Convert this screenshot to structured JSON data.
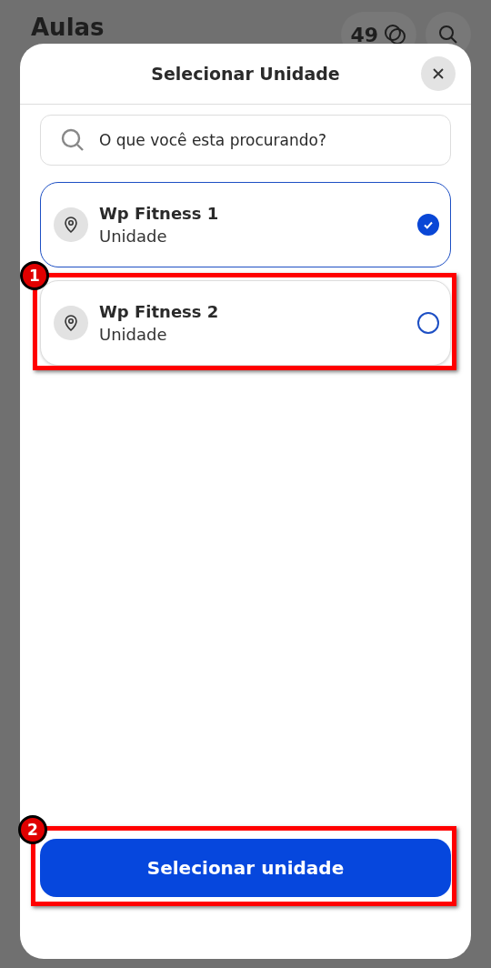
{
  "background": {
    "title": "Aulas",
    "credits": "49"
  },
  "modal": {
    "title": "Selecionar Unidade",
    "search": {
      "placeholder": "O que você esta procurando?"
    },
    "units": [
      {
        "name": "Wp Fitness 1",
        "subtitle": "Unidade",
        "selected": true
      },
      {
        "name": "Wp Fitness 2",
        "subtitle": "Unidade",
        "selected": false
      }
    ],
    "button": "Selecionar unidade"
  },
  "annotations": [
    {
      "label": "1"
    },
    {
      "label": "2"
    }
  ]
}
